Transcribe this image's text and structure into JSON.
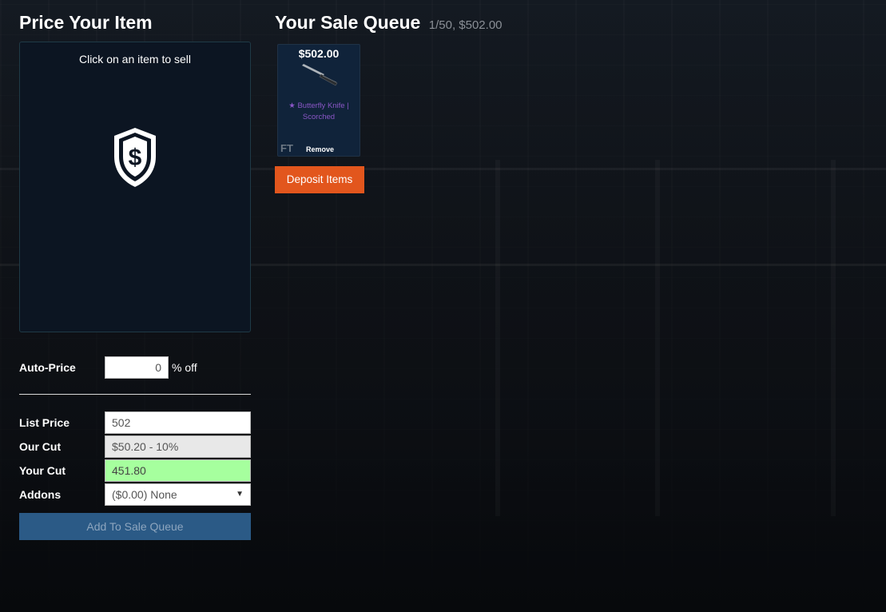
{
  "price_panel": {
    "title": "Price Your Item",
    "select_hint": "Click on an item to sell",
    "auto_price": {
      "label": "Auto-Price",
      "value": "0",
      "suffix": "% off"
    },
    "list_price": {
      "label": "List Price",
      "value": "502"
    },
    "our_cut": {
      "label": "Our Cut",
      "value": "$50.20 - 10%"
    },
    "your_cut": {
      "label": "Your Cut",
      "value": "451.80"
    },
    "addons": {
      "label": "Addons",
      "selected": "($0.00) None"
    },
    "add_button": "Add To Sale Queue"
  },
  "sale_queue": {
    "title": "Your Sale Queue",
    "meta": "1/50, $502.00",
    "items": [
      {
        "price": "$502.00",
        "name": "★ Butterfly Knife | Scorched",
        "wear": "FT",
        "remove_label": "Remove"
      }
    ],
    "deposit_button": "Deposit Items"
  },
  "colors": {
    "accent_orange": "#e2561d",
    "button_blue": "#2b5a86",
    "your_cut_green": "#a6ff9e",
    "item_name_purple": "#8a56c6"
  }
}
